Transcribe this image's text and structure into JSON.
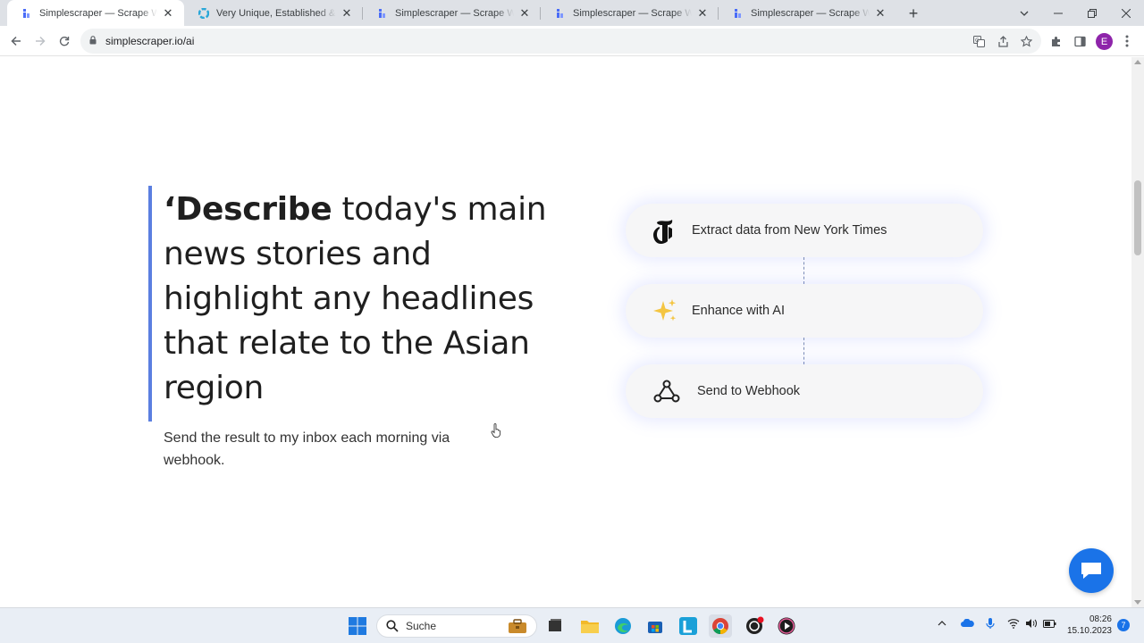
{
  "browser": {
    "tabs": [
      {
        "title": "Simplescraper — Scrape Website",
        "active": true,
        "favicon": "simplescraper-favicon"
      },
      {
        "title": "Very Unique, Established & Highly",
        "active": false,
        "favicon": "colorful-swirl-favicon"
      },
      {
        "title": "Simplescraper — Scrape Website",
        "active": false,
        "favicon": "simplescraper-favicon"
      },
      {
        "title": "Simplescraper — Scrape Website",
        "active": false,
        "favicon": "simplescraper-favicon"
      },
      {
        "title": "Simplescraper — Scrape Website",
        "active": false,
        "favicon": "simplescraper-favicon"
      }
    ],
    "url": "simplescraper.io/ai",
    "profile_initial": "E"
  },
  "page": {
    "quote_open": "‘",
    "quote_bold": "Describe",
    "quote_rest": " today's main news stories and highlight any headlines that relate to the Asian region",
    "quote_sub": "Send the result to my inbox each morning via webhook.",
    "steps": [
      {
        "label": "Extract data from New York Times",
        "icon": "nyt-logo-icon"
      },
      {
        "label": "Enhance with AI",
        "icon": "sparkles-icon"
      },
      {
        "label": "Send to Webhook",
        "icon": "webhook-icon"
      }
    ]
  },
  "taskbar": {
    "search_placeholder": "Suche",
    "time": "08:26",
    "date": "15.10.2023",
    "notification_count": "7"
  },
  "colors": {
    "accent_bar": "#5b7fe0",
    "chat_button": "#1a73e8",
    "sparkle": "#f4c542"
  }
}
